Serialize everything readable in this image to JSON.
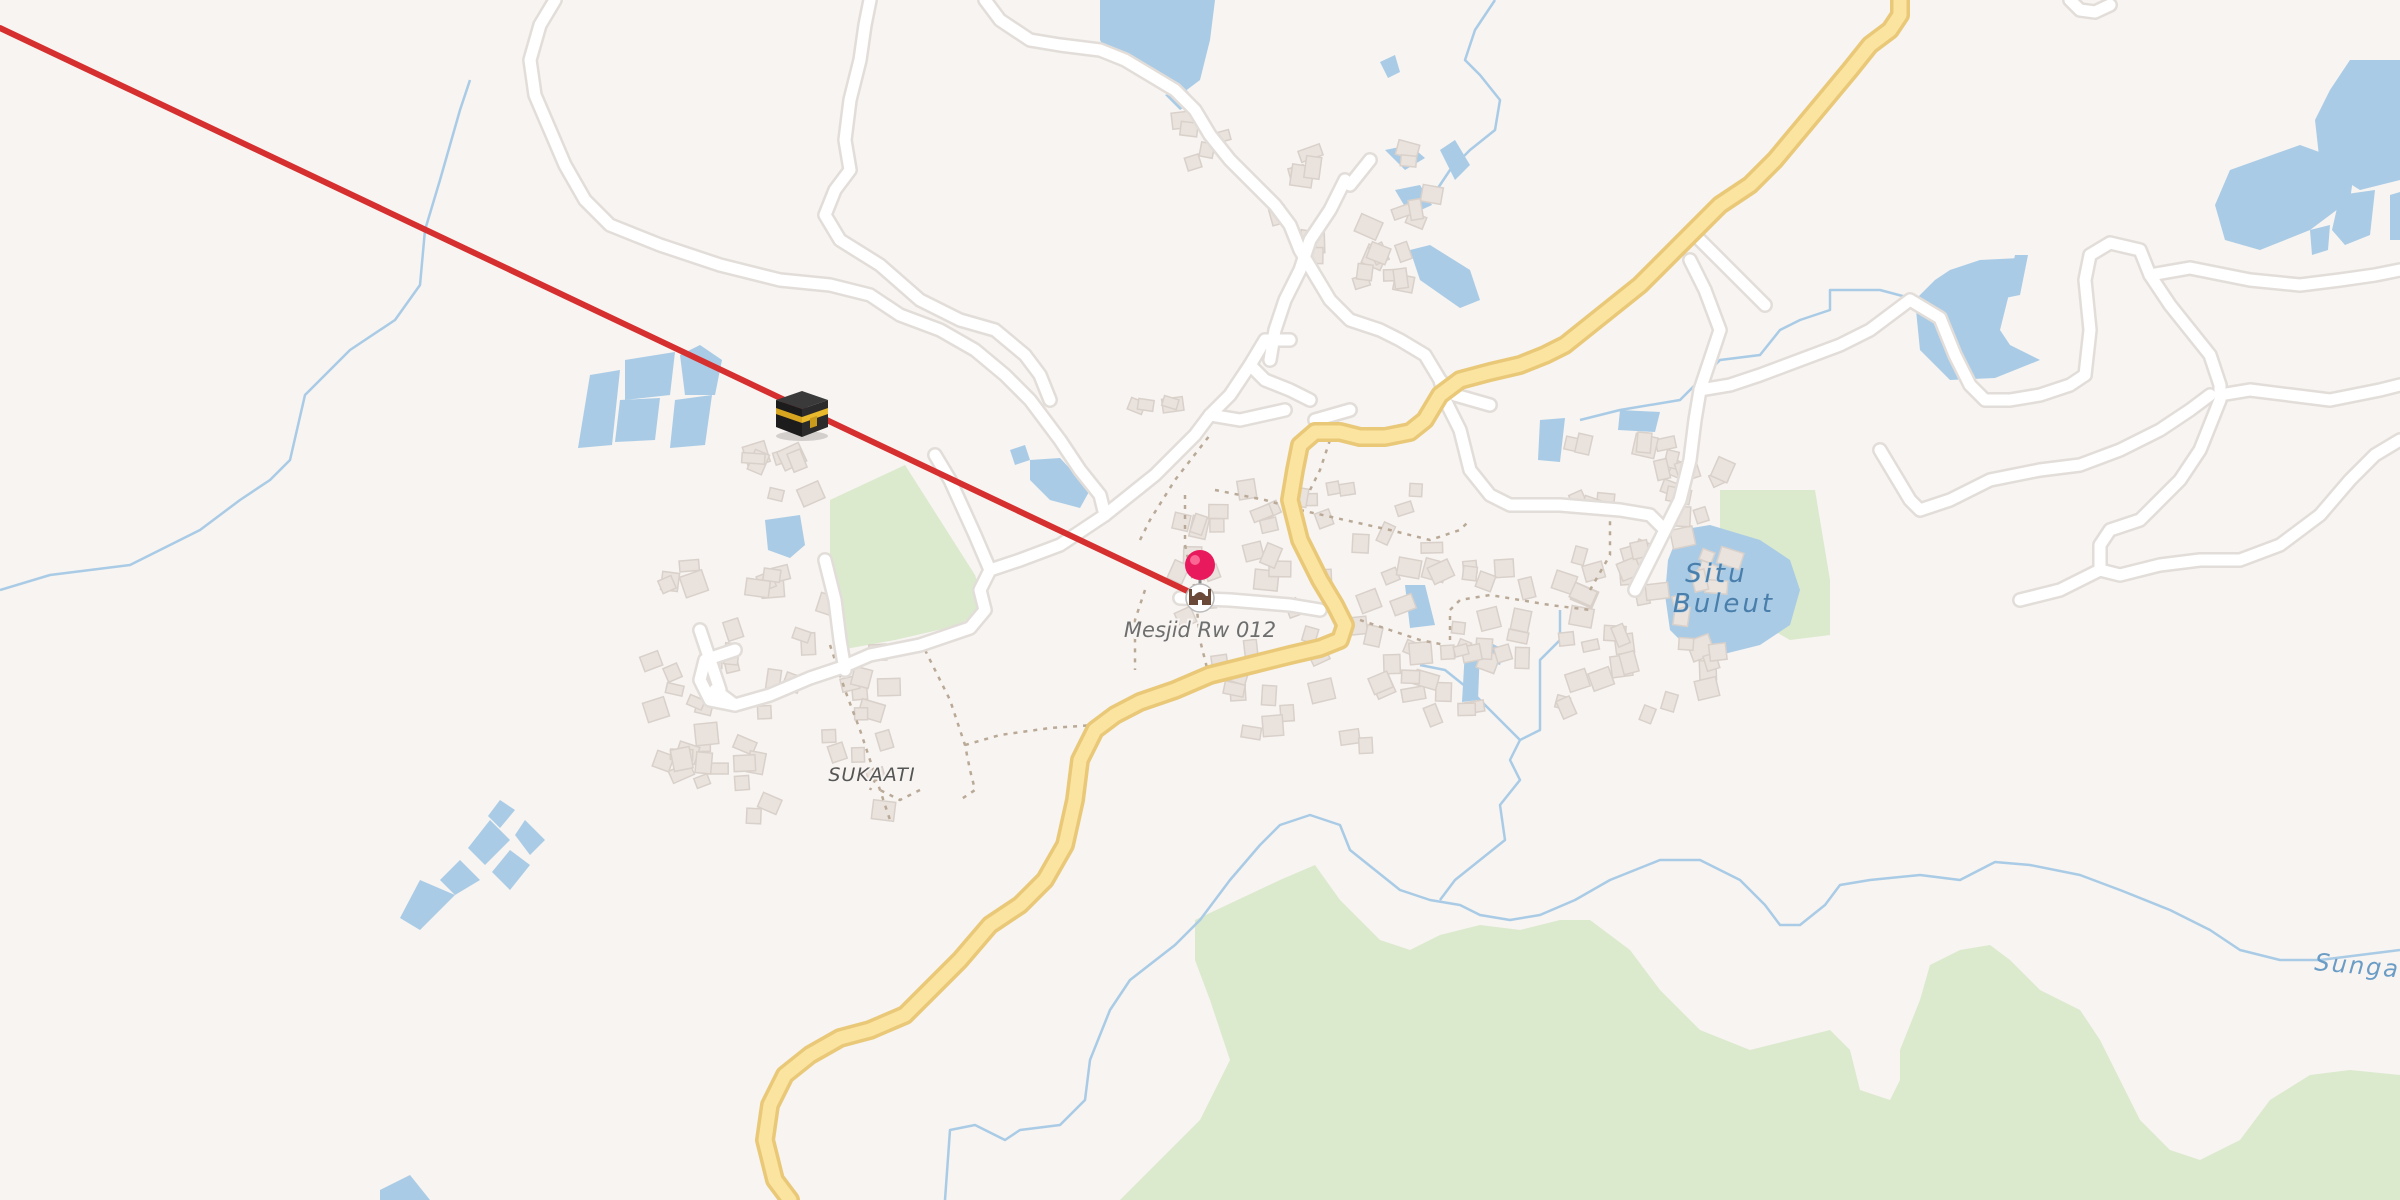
{
  "map": {
    "colors": {
      "land": "#f7f4f1",
      "water": "#a9cbe6",
      "stream": "#a9cbe6",
      "park": "#dbe9cd",
      "road": "#ffffff",
      "road_casing": "#e2ddd8",
      "main_road": "#fbe3a0",
      "main_road_casing": "#e9c878",
      "building": "#e9e2dd",
      "building_edge": "#d9d0ca",
      "path": "#b9a996",
      "qibla_line": "#d62f2f",
      "pin": "#e8195c"
    },
    "labels": {
      "poi": "Mesjid Rw 012",
      "lake": "Situ Buleut",
      "lake_line1": "Situ",
      "lake_line2": "Buleut",
      "village": "SUKAATI",
      "river": "Sungai"
    },
    "icons": {
      "kaaba": "kaaba-icon",
      "pin": "location-pin-icon",
      "mosque": "mosque-icon"
    }
  }
}
